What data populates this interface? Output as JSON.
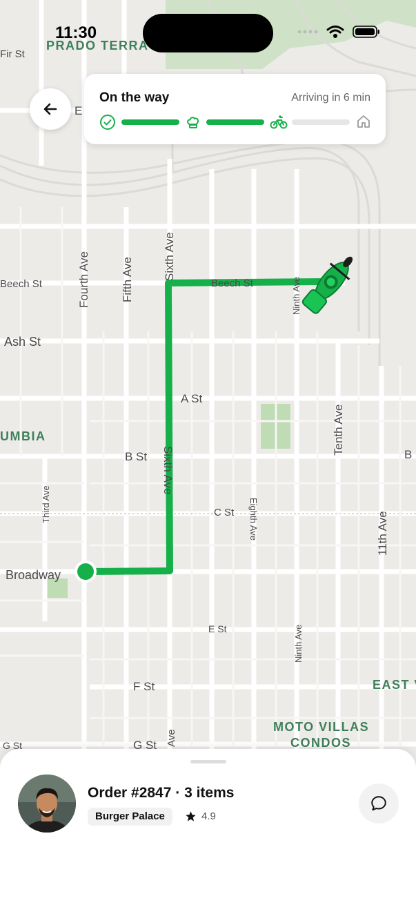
{
  "status_bar": {
    "time": "11:30"
  },
  "tracking": {
    "title": "On the way",
    "eta": "Arriving in 6 min",
    "steps": [
      "check-icon",
      "chef-hat-icon",
      "bicycle-icon",
      "home-icon"
    ],
    "accent_color": "#16b04a"
  },
  "map": {
    "areas": [
      "PRADO TERRA",
      "UMBIA",
      "EAST V",
      "MOTO VILLAS",
      "CONDOS"
    ],
    "streets": {
      "fir": "Fir St",
      "e_top": "E",
      "beech_left": "Beech St",
      "beech_route": "Beech St",
      "ash": "Ash St",
      "a": "A St",
      "b": "B St",
      "b_right": "B",
      "c": "C St",
      "broadway": "Broadway",
      "e": "E St",
      "f": "F St",
      "g_left": "G St",
      "g_mid": "G St",
      "fourth": "Fourth Ave",
      "fifth": "Fifth Ave",
      "sixth_top": "Sixth Ave",
      "sixth_mid": "Sixth Ave",
      "sixth_bottom": "Ave",
      "third": "Third Ave",
      "eighth": "Eighth Ave",
      "ninth_top": "Ninth Ave",
      "ninth_bottom": "Ninth Ave",
      "tenth": "Tenth Ave",
      "eleventh": "11th Ave"
    }
  },
  "order": {
    "title": "Order #2847 · 3 items",
    "restaurant": "Burger Palace",
    "rating": "4.9"
  }
}
